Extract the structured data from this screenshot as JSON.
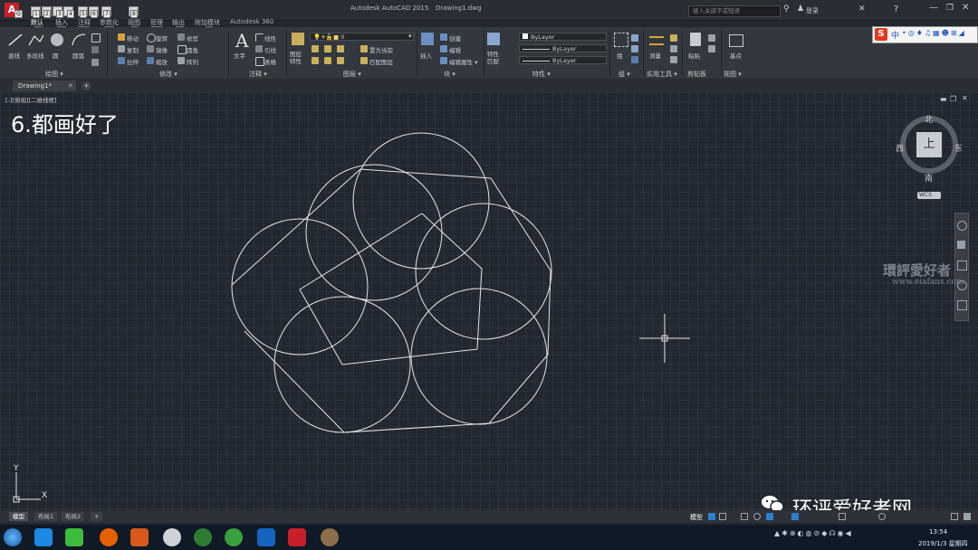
{
  "app": {
    "title": "Autodesk AutoCAD 2015",
    "file": "Drawing1.dwg",
    "search_placeholder": "键入关键字或短语",
    "login": "登录",
    "help": "?"
  },
  "qat_tips": [
    "Q",
    "1",
    "2",
    "3",
    "4",
    "5",
    "6",
    "7",
    "8"
  ],
  "ribbon_tabs": [
    {
      "label": "默认",
      "tip": "H"
    },
    {
      "label": "插入",
      "tip": "IN"
    },
    {
      "label": "注释",
      "tip": "AN"
    },
    {
      "label": "参数化",
      "tip": "PA"
    },
    {
      "label": "视图",
      "tip": "V"
    },
    {
      "label": "管理",
      "tip": "MA"
    },
    {
      "label": "输出",
      "tip": "O"
    },
    {
      "label": "附加模块",
      "tip": "X"
    },
    {
      "label": "Autodesk 360",
      "tip": ""
    }
  ],
  "ribbon": {
    "draw": {
      "line": "直线",
      "polyline": "多段线",
      "circle": "圆",
      "arc": "圆弧",
      "panel": "绘图 ▾"
    },
    "modify": {
      "move": "移动",
      "rotate": "旋转",
      "trim": "修剪",
      "copy": "复制",
      "mirror": "镜像",
      "fillet": "圆角",
      "stretch": "拉伸",
      "scale": "缩放",
      "array": "阵列",
      "panel": "修改 ▾"
    },
    "annotate": {
      "text": "文字",
      "linear": "线性",
      "leader": "引线",
      "table": "表格",
      "panel": "注释 ▾"
    },
    "layers": {
      "layer_props": "图层特性",
      "layer_value": "0",
      "make_current": "置为当前",
      "match_layer": "匹配图层",
      "panel": "图层 ▾"
    },
    "block": {
      "insert": "插入",
      "create": "创建",
      "edit": "编辑",
      "edit_attr": "编辑属性 ▾",
      "panel": "块 ▾"
    },
    "properties": {
      "match": "特性匹配",
      "color": "ByLayer",
      "linetype": "ByLayer",
      "lineweight": "ByLayer",
      "panel": "特性 ▾"
    },
    "groups": {
      "group": "组",
      "panel": "组 ▾"
    },
    "utilities": {
      "measure": "测量",
      "panel": "实用工具 ▾"
    },
    "clipboard": {
      "paste": "粘贴",
      "panel": "剪贴板"
    },
    "view": {
      "base": "基点",
      "panel": "视图 ▾"
    }
  },
  "doc_tab": "Drawing1*",
  "viewport_label": "[-][俯视][二维线框]",
  "step_caption": "6.都画好了",
  "viewcube": {
    "north": "北",
    "south": "南",
    "east": "东",
    "west": "西",
    "top": "上",
    "wcs": "WCS"
  },
  "watermark": {
    "line1": "環評愛好者",
    "line2": "www.eiafans.com"
  },
  "ucs": {
    "x": "X",
    "y": "Y"
  },
  "layout_tabs": [
    "模型",
    "布局1",
    "布局2",
    "+"
  ],
  "status": {
    "model": "模型"
  },
  "wechat_brand": "环评爱好者网",
  "taskbar": {
    "time": "13:54",
    "date": "2019/1/3 星期四"
  },
  "ime": "中"
}
